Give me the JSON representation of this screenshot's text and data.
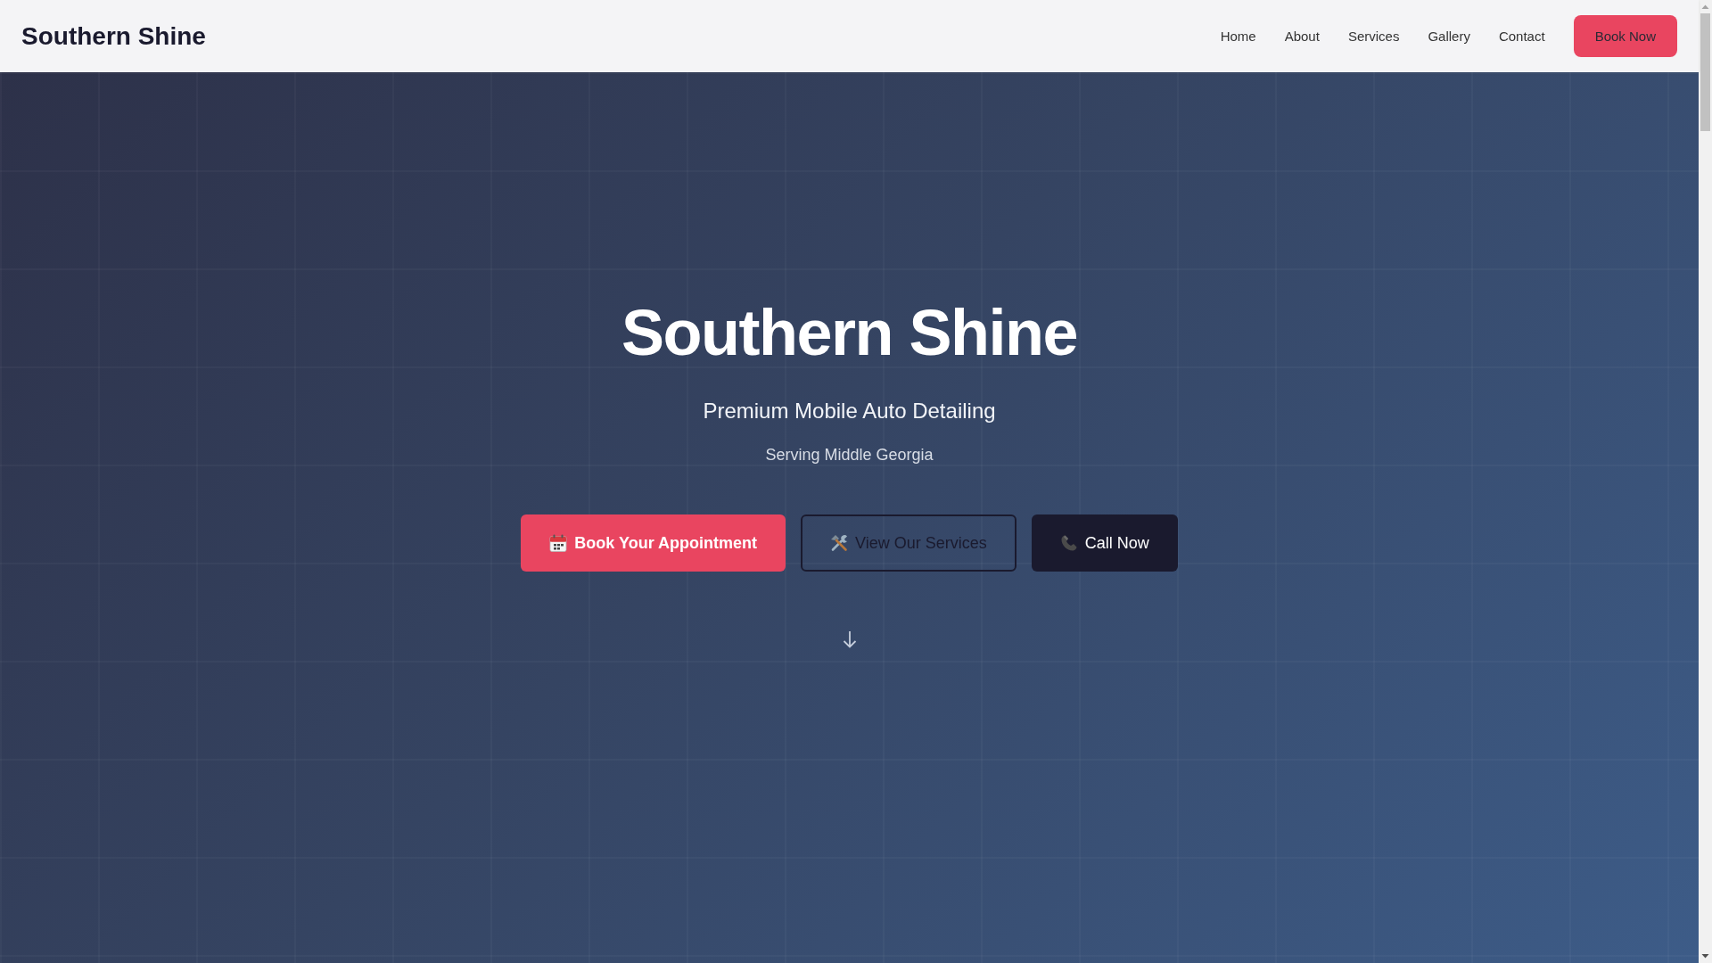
{
  "header": {
    "logo": "Southern Shine",
    "nav": [
      "Home",
      "About",
      "Services",
      "Gallery",
      "Contact"
    ],
    "cta": "Book Now"
  },
  "hero": {
    "title": "Southern Shine",
    "subtitle": "Premium Mobile Auto Detailing",
    "tagline": "Serving Middle Georgia",
    "buttons": [
      {
        "label": "Book Your Appointment",
        "kind": "primary"
      },
      {
        "label": "View Our Services",
        "kind": "outline"
      },
      {
        "label": "Call Now",
        "kind": "dark"
      }
    ]
  }
}
